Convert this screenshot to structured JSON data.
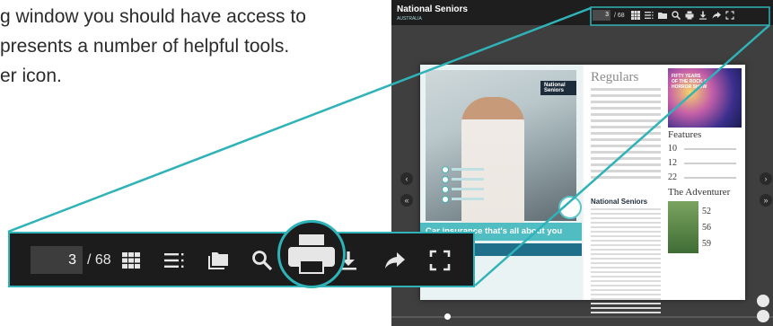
{
  "document": {
    "lines": [
      "g window you should have access to",
      "presents a number of helpful tools.",
      "er icon."
    ]
  },
  "viewer": {
    "brand": "National Seniors",
    "brand_sub": "AUSTRALIA",
    "toolbar": {
      "page_value": "3",
      "page_total": "/ 68"
    },
    "left_page": {
      "badge": "National Seniors",
      "headline": "Car insurance that's all about you"
    },
    "right_page": {
      "regulars_title": "Regulars",
      "concert_caption": "FIFTY YEARS OF THE ROCK & HORROR SHOW",
      "features_title": "Features",
      "feature_numbers": [
        "10",
        "12",
        "22"
      ],
      "logo": "National Seniors",
      "adventurer_title": "The Adventurer",
      "adventurer_numbers": [
        "52",
        "56",
        "59"
      ]
    },
    "nav": {
      "prev": "‹",
      "next": "›",
      "first": "«",
      "last": "»"
    }
  },
  "big_toolbar": {
    "page_value": "3",
    "page_total": "/ 68",
    "icons": [
      "thumbnails-icon",
      "table-of-contents-icon",
      "folder-icon",
      "search-icon",
      "print-icon",
      "download-icon",
      "share-icon",
      "fullscreen-icon"
    ]
  },
  "colors": {
    "accent_teal": "#2fb3b8",
    "toolbar_bg": "#1c1c1c",
    "viewer_bg": "#3f3f3f"
  }
}
